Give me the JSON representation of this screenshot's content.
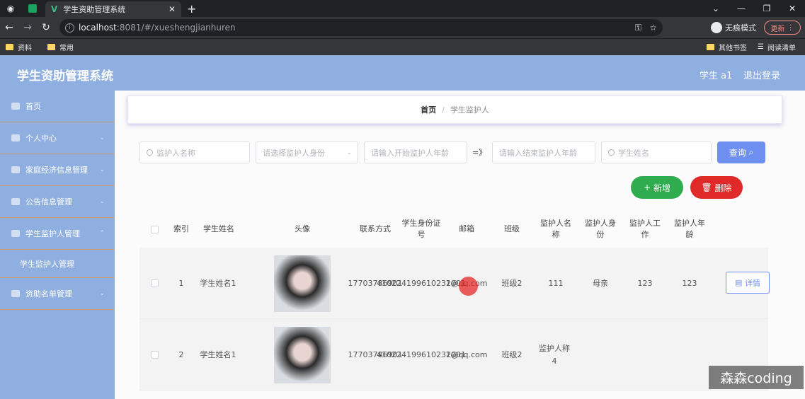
{
  "browser": {
    "tab_title": "学生资助管理系统",
    "url_host": "localhost",
    "url_path": ":8081/#/xueshengjianhuren",
    "incognito_label": "无痕模式",
    "update_label": "更新",
    "bookmarks": [
      "资料",
      "常用"
    ],
    "bookmarks_right": [
      "其他书签",
      "阅读清单"
    ]
  },
  "app": {
    "title": "学生资助管理系统",
    "user": "学生 a1",
    "logout": "退出登录"
  },
  "sidebar": {
    "items": [
      {
        "label": "首页"
      },
      {
        "label": "个人中心"
      },
      {
        "label": "家庭经济信息管理"
      },
      {
        "label": "公告信息管理"
      },
      {
        "label": "学生监护人管理"
      },
      {
        "label": "资助名单管理"
      }
    ],
    "subitem": "学生监护人管理"
  },
  "breadcrumb": {
    "home": "首页",
    "sep": "/",
    "current": "学生监护人"
  },
  "search": {
    "guardian_name_placeholder": "监护人名称",
    "guardian_identity_placeholder": "请选择监护人身份",
    "age_start_placeholder": "请输入开始监护人年龄",
    "arrow": "=》",
    "age_end_placeholder": "请输入结束监护人年龄",
    "student_name_placeholder": "学生姓名",
    "query_label": "查询"
  },
  "actions": {
    "add_label": "新增",
    "delete_label": "删除"
  },
  "table": {
    "headers": [
      "索引",
      "学生姓名",
      "头像",
      "联系方式",
      "学生身份证号",
      "邮箱",
      "班级",
      "监护人名称",
      "监护人身份",
      "监护人工作",
      "监护人年龄"
    ],
    "rows": [
      {
        "index": "1",
        "name": "学生姓名1",
        "phone": "17703786901",
        "idcard": "410224199610232001",
        "email": "1@qq.com",
        "class": "班级2",
        "guardian": "111",
        "identity": "母亲",
        "work": "123",
        "age": "123",
        "detail": "详情"
      },
      {
        "index": "2",
        "name": "学生姓名1",
        "phone": "17703786901",
        "idcard": "410224199610232001",
        "email": "1@qq.com",
        "class": "班级2",
        "guardian": "监护人称4",
        "identity": "",
        "work": "",
        "age": "",
        "detail": ""
      }
    ]
  },
  "watermark": "森森coding"
}
